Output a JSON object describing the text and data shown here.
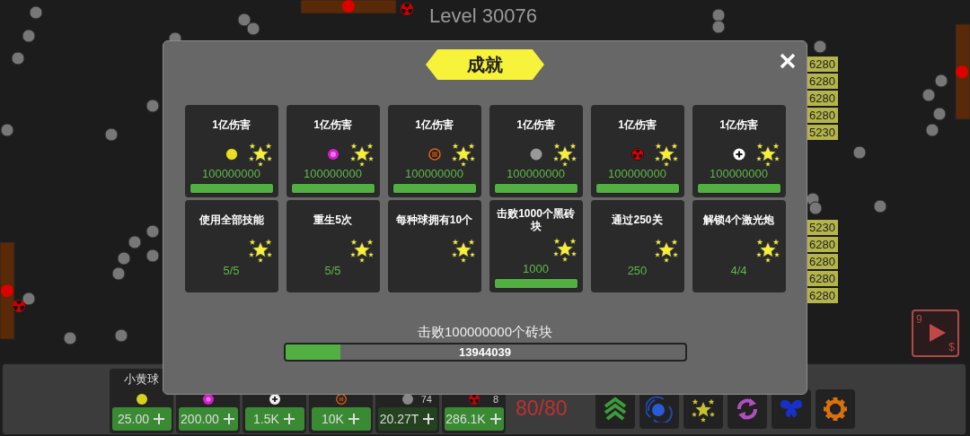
{
  "level_label": "Level 30076",
  "bricks_upper": [
    {
      "value": "6280"
    },
    {
      "value": "6280"
    },
    {
      "value": "6280"
    },
    {
      "value": "6280"
    },
    {
      "value": "5230"
    }
  ],
  "bricks_lower": [
    {
      "value": "5230"
    },
    {
      "value": "6280"
    },
    {
      "value": "6280"
    },
    {
      "value": "6280"
    },
    {
      "value": "6280"
    }
  ],
  "speed_button": {
    "count": "9",
    "currency": "$"
  },
  "achievements": {
    "title": "成就",
    "items": [
      {
        "kind": "yellow",
        "title": "1亿伤害",
        "value": "100000000",
        "level": 1
      },
      {
        "kind": "pink",
        "title": "1亿伤害",
        "value": "100000000",
        "level": 1
      },
      {
        "kind": "orange",
        "title": "1亿伤害",
        "value": "100000000",
        "level": 1
      },
      {
        "kind": "gray",
        "title": "1亿伤害",
        "value": "100000000",
        "level": 1
      },
      {
        "kind": "red",
        "title": "1亿伤害",
        "value": "100000000",
        "level": 1
      },
      {
        "kind": "white",
        "title": "1亿伤害",
        "value": "100000000",
        "level": 1
      },
      {
        "kind": "plain",
        "title": "使用全部技能",
        "value": "5/5"
      },
      {
        "kind": "plain",
        "title": "重生5次",
        "value": "5/5"
      },
      {
        "kind": "plain",
        "title": "每种球拥有10个"
      },
      {
        "kind": "plain",
        "title": "击败1000个黑砖块",
        "value": "1000",
        "level": 1
      },
      {
        "kind": "plain",
        "title": "通过250关",
        "value": "250"
      },
      {
        "kind": "plain",
        "title": "解锁4个激光炮",
        "value": "4/4"
      }
    ],
    "goal": {
      "label": "击败100000000个砖块",
      "reading": "13944039",
      "level": 0.139
    }
  },
  "shop": [
    {
      "kind": "yellow",
      "label": "小黄球",
      "price": "25.00",
      "affordable": true
    },
    {
      "kind": "pink",
      "price": "200.00",
      "affordable": true
    },
    {
      "kind": "white",
      "price": "1.5K",
      "affordable": true
    },
    {
      "kind": "orange",
      "price": "10K",
      "affordable": true
    },
    {
      "kind": "gray",
      "count": "74",
      "price": "20.27T",
      "affordable": false
    },
    {
      "kind": "red",
      "count": "8",
      "price": "286.1K",
      "affordable": true
    }
  ],
  "ball_count": "80/80",
  "skills": [
    {
      "kind": "upgrade"
    },
    {
      "kind": "vortex"
    },
    {
      "kind": "stars"
    },
    {
      "kind": "refresh"
    },
    {
      "kind": "wings"
    },
    {
      "kind": "gear"
    }
  ]
}
